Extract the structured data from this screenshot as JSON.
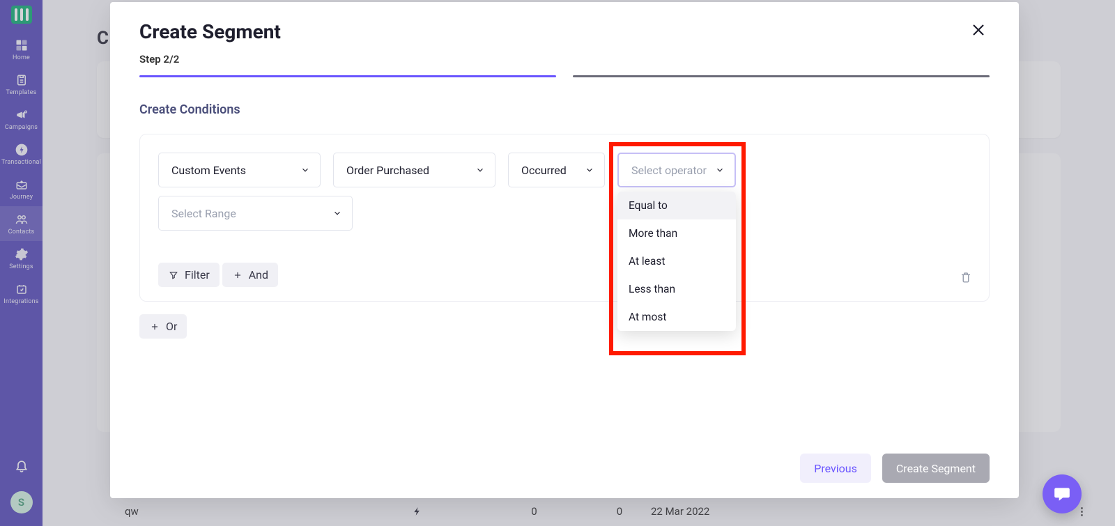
{
  "sidebar": {
    "items": [
      {
        "label": "Home"
      },
      {
        "label": "Templates"
      },
      {
        "label": "Campaigns"
      },
      {
        "label": "Transactional"
      },
      {
        "label": "Journey"
      },
      {
        "label": "Contacts"
      },
      {
        "label": "Settings"
      },
      {
        "label": "Integrations"
      }
    ],
    "avatar_initial": "S"
  },
  "page": {
    "title_prefix": "C",
    "row": {
      "name": "qw",
      "value_a": "0",
      "value_b": "0",
      "date": "22 Mar 2022",
      "menu": "⋮"
    }
  },
  "modal": {
    "title": "Create Segment",
    "step": "Step 2/2",
    "section_label": "Create Conditions",
    "selects": {
      "event_type": "Custom Events",
      "event_name": "Order Purchased",
      "occurrence": "Occurred",
      "operator_placeholder": "Select operator",
      "range_placeholder": "Select Range"
    },
    "operator_options": [
      "Equal to",
      "More than",
      "At least",
      "Less than",
      "At most"
    ],
    "buttons": {
      "filter": "Filter",
      "and": "And",
      "or": "Or",
      "previous": "Previous",
      "create": "Create Segment"
    }
  }
}
